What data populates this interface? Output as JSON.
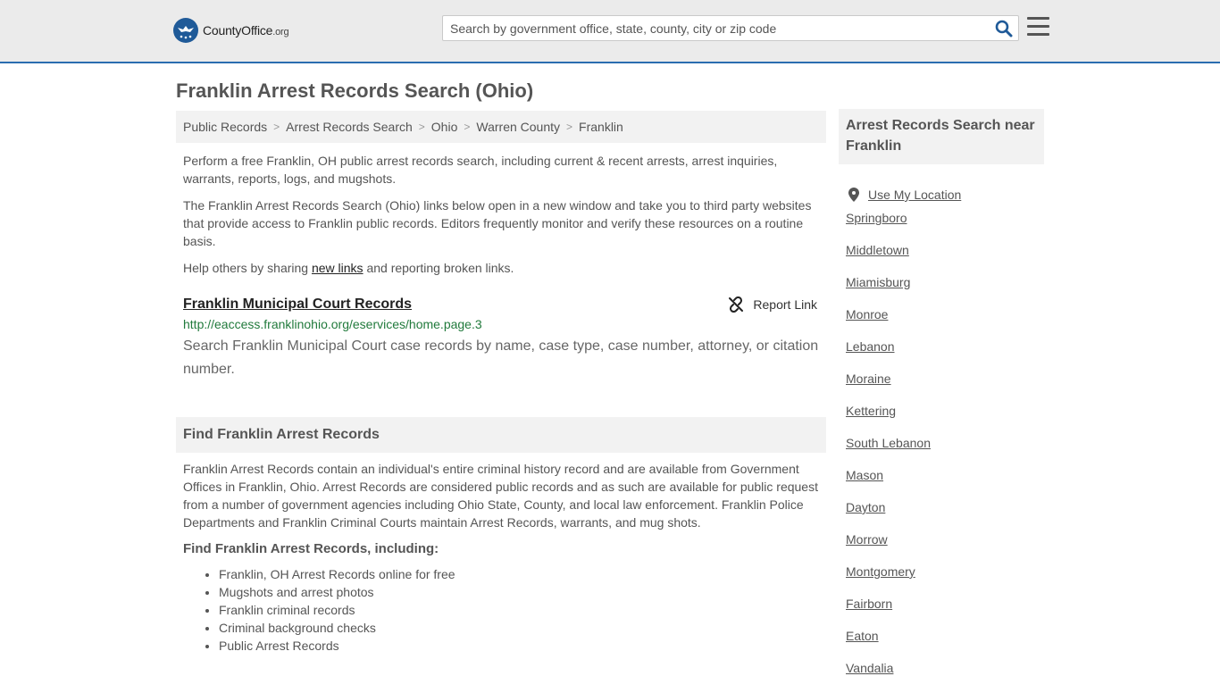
{
  "header": {
    "logo_main": "CountyOffice",
    "logo_suffix": ".org",
    "search_placeholder": "Search by government office, state, county, city or zip code"
  },
  "page_title": "Franklin Arrest Records Search (Ohio)",
  "breadcrumb": [
    "Public Records",
    "Arrest Records Search",
    "Ohio",
    "Warren County",
    "Franklin"
  ],
  "intro": {
    "p1": "Perform a free Franklin, OH public arrest records search, including current & recent arrests, arrest inquiries, warrants, reports, logs, and mugshots.",
    "p2": "The Franklin Arrest Records Search (Ohio) links below open in a new window and take you to third party websites that provide access to Franklin public records. Editors frequently monitor and verify these resources on a routine basis.",
    "p3_before": "Help others by sharing ",
    "p3_link": "new links",
    "p3_after": " and reporting broken links."
  },
  "result": {
    "title": "Franklin Municipal Court Records",
    "report_label": "Report Link",
    "url": "http://eaccess.franklinohio.org/eservices/home.page.3",
    "description": "Search Franklin Municipal Court case records by name, case type, case number, attorney, or citation number."
  },
  "find_section": {
    "heading": "Find Franklin Arrest Records",
    "body": "Franklin Arrest Records contain an individual's entire criminal history record and are available from Government Offices in Franklin, Ohio. Arrest Records are considered public records and as such are available for public request from a number of government agencies including Ohio State, County, and local law enforcement. Franklin Police Departments and Franklin Criminal Courts maintain Arrest Records, warrants, and mug shots.",
    "subheading": "Find Franklin Arrest Records, including:",
    "items": [
      "Franklin, OH Arrest Records online for free",
      "Mugshots and arrest photos",
      "Franklin criminal records",
      "Criminal background checks",
      "Public Arrest Records"
    ]
  },
  "sidebar": {
    "heading": "Arrest Records Search near Franklin",
    "location_label": "Use My Location",
    "cities": [
      "Springboro",
      "Middletown",
      "Miamisburg",
      "Monroe",
      "Lebanon",
      "Moraine",
      "Kettering",
      "South Lebanon",
      "Mason",
      "Dayton",
      "Morrow",
      "Montgomery",
      "Fairborn",
      "Eaton",
      "Vandalia"
    ]
  }
}
